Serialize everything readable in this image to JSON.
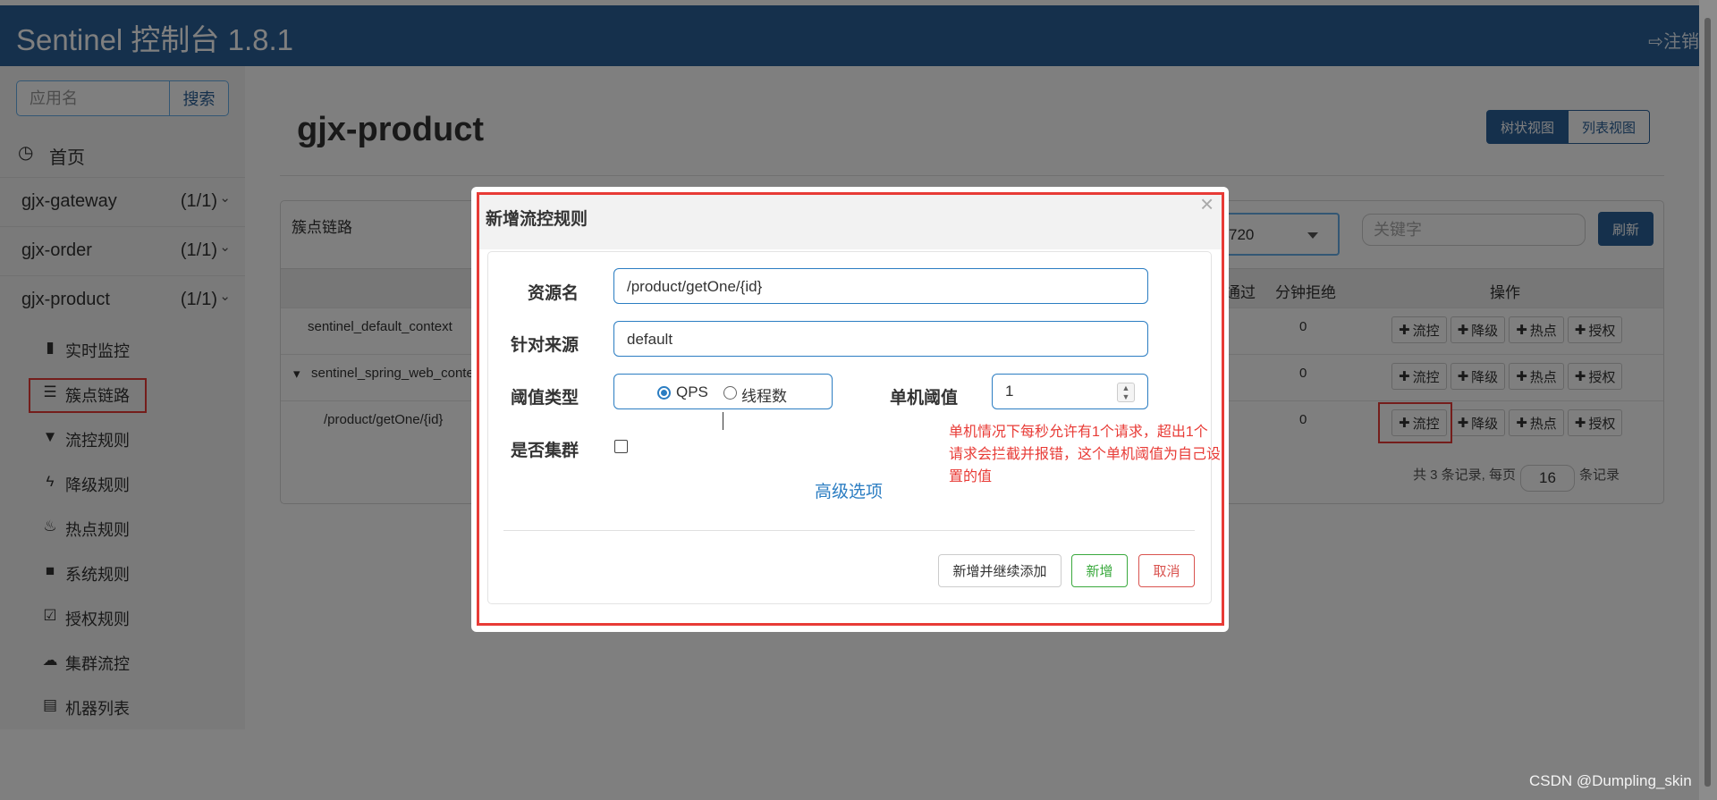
{
  "header": {
    "brand": "Sentinel 控制台 1.8.1",
    "logout": "⇨注销"
  },
  "sidebar": {
    "search_placeholder": "应用名",
    "search_button": "搜索",
    "home": "首页",
    "apps": [
      {
        "name": "gjx-gateway",
        "count": "(1/1)"
      },
      {
        "name": "gjx-order",
        "count": "(1/1)"
      },
      {
        "name": "gjx-product",
        "count": "(1/1)"
      }
    ],
    "submenu": [
      {
        "icon": "bar-chart-icon",
        "label": "实时监控"
      },
      {
        "icon": "list-alt-icon",
        "label": "簇点链路"
      },
      {
        "icon": "filter-icon",
        "label": "流控规则"
      },
      {
        "icon": "flash-icon",
        "label": "降级规则"
      },
      {
        "icon": "fire-icon",
        "label": "热点规则"
      },
      {
        "icon": "lock-icon",
        "label": "系统规则"
      },
      {
        "icon": "check-icon",
        "label": "授权规则"
      },
      {
        "icon": "cloud-icon",
        "label": "集群流控"
      },
      {
        "icon": "th-list-icon",
        "label": "机器列表"
      }
    ]
  },
  "main": {
    "title": "gjx-product",
    "view_tree": "树状视图",
    "view_list": "列表视图",
    "panel_title": "簇点链路",
    "machine_select": "720",
    "keyword_placeholder": "关键字",
    "refresh": "刷新",
    "columns": {
      "pass": "通过",
      "block": "分钟拒绝",
      "ops": "操作"
    },
    "rows": [
      {
        "resource": "sentinel_default_context",
        "block": "0"
      },
      {
        "resource": "sentinel_spring_web_conte",
        "block": "0"
      },
      {
        "resource": "/product/getOne/{id}",
        "block": "0"
      }
    ],
    "op_buttons": [
      "流控",
      "降级",
      "热点",
      "授权"
    ],
    "pager": {
      "prefix": "共 3 条记录, 每页",
      "size": "16",
      "suffix": "条记录"
    }
  },
  "modal": {
    "title": "新增流控规则",
    "close": "×",
    "resource_label": "资源名",
    "resource_value": "/product/getOne/{id}",
    "origin_label": "针对来源",
    "origin_value": "default",
    "threshold_type_label": "阈值类型",
    "threshold_options": [
      "QPS",
      "线程数"
    ],
    "threshold_selected": "QPS",
    "threshold_label": "单机阈值",
    "threshold_value": "1",
    "cluster_label": "是否集群",
    "cluster_checked": false,
    "advanced": "高级选项",
    "note": "单机情况下每秒允许有1个请求，超出1个请求会拦截并报错，这个单机阈值为自己设置的值",
    "btn_continue": "新增并继续添加",
    "btn_add": "新增",
    "btn_cancel": "取消"
  },
  "watermark": "CSDN @Dumpling_skin",
  "colors": {
    "header": "#2b6199",
    "primary": "#2b6199",
    "annotation": "#e83b36",
    "success": "#3aa93d",
    "danger": "#d9534f"
  }
}
